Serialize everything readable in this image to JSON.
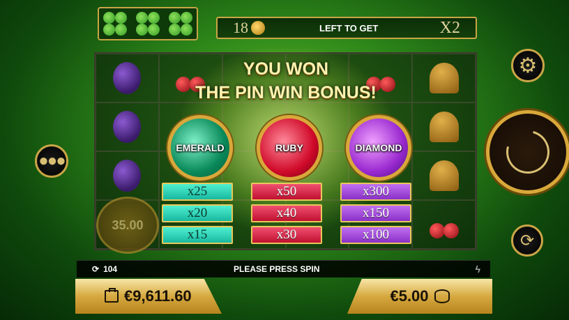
{
  "bonus_progress": {
    "count": "18",
    "label": "LEFT TO GET",
    "multiplier": "X2"
  },
  "coin_value": "35.00",
  "win_title": [
    "YOU WON",
    "THE PIN WIN BONUS!"
  ],
  "gems": [
    {
      "name": "EMERALD",
      "multipliers": [
        "x25",
        "x20",
        "x15"
      ]
    },
    {
      "name": "RUBY",
      "multipliers": [
        "x50",
        "x40",
        "x30"
      ]
    },
    {
      "name": "DIAMOND",
      "multipliers": [
        "x300",
        "x150",
        "x100"
      ]
    }
  ],
  "status": {
    "spins_left": "104",
    "message": "PLEASE PRESS SPIN"
  },
  "balance": "€9,611.60",
  "bet": "€5.00",
  "icons": {
    "settings": "gear-icon",
    "menu": "more-dots-icon",
    "spin": "spin-icon",
    "autoplay": "autoplay-icon"
  },
  "colors": {
    "gold": "#c9a546",
    "emerald": "#18b8a0",
    "ruby": "#c01030",
    "diamond": "#8a30c8"
  }
}
